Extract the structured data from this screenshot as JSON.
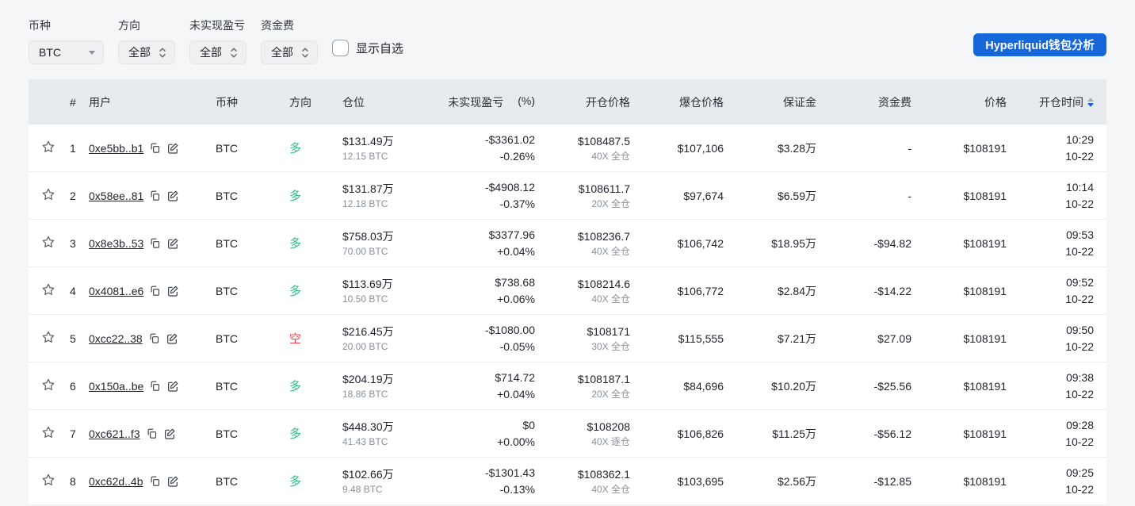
{
  "filters": {
    "coin_label": "币种",
    "coin_value": "BTC",
    "direction_label": "方向",
    "direction_value": "全部",
    "pnl_label": "未实现盈亏",
    "pnl_value": "全部",
    "funding_label": "资金费",
    "funding_value": "全部",
    "show_favorites_label": "显示自选"
  },
  "wallet_button_label": "Hyperliquid钱包分析",
  "colors": {
    "accent": "#1667d9",
    "green": "#2ebd85",
    "red": "#ef454a"
  },
  "table": {
    "headers": {
      "rank": "#",
      "user": "用户",
      "coin": "币种",
      "direction": "方向",
      "position": "仓位",
      "pnl": "未实现盈亏",
      "pnl_pct": "(%)",
      "open_price": "开仓价格",
      "liq_price": "爆仓价格",
      "margin": "保证金",
      "funding": "资金费",
      "price": "价格",
      "open_time": "开仓时间"
    },
    "rows": [
      {
        "rank": "1",
        "user": "0xe5bb..b1",
        "coin": "BTC",
        "direction": "多",
        "direction_type": "long",
        "position_usd": "$131.49万",
        "position_coin": "12.15 BTC",
        "pnl": "-$3361.02",
        "pnl_pct": "-0.26%",
        "pnl_type": "negative",
        "open_price": "$108487.5",
        "leverage": "40X 全仓",
        "liq_price": "$107,106",
        "margin": "$3.28万",
        "funding": "-",
        "funding_type": "neutral",
        "price": "$108191",
        "time": "10:29",
        "date": "10-22"
      },
      {
        "rank": "2",
        "user": "0x58ee..81",
        "coin": "BTC",
        "direction": "多",
        "direction_type": "long",
        "position_usd": "$131.87万",
        "position_coin": "12.18 BTC",
        "pnl": "-$4908.12",
        "pnl_pct": "-0.37%",
        "pnl_type": "negative",
        "open_price": "$108611.7",
        "leverage": "20X 全仓",
        "liq_price": "$97,674",
        "margin": "$6.59万",
        "funding": "-",
        "funding_type": "neutral",
        "price": "$108191",
        "time": "10:14",
        "date": "10-22"
      },
      {
        "rank": "3",
        "user": "0x8e3b..53",
        "coin": "BTC",
        "direction": "多",
        "direction_type": "long",
        "position_usd": "$758.03万",
        "position_coin": "70.00 BTC",
        "pnl": "$3377.96",
        "pnl_pct": "+0.04%",
        "pnl_type": "positive",
        "open_price": "$108236.7",
        "leverage": "40X 全仓",
        "liq_price": "$106,742",
        "margin": "$18.95万",
        "funding": "-$94.82",
        "funding_type": "negative",
        "price": "$108191",
        "time": "09:53",
        "date": "10-22"
      },
      {
        "rank": "4",
        "user": "0x4081..e6",
        "coin": "BTC",
        "direction": "多",
        "direction_type": "long",
        "position_usd": "$113.69万",
        "position_coin": "10.50 BTC",
        "pnl": "$738.68",
        "pnl_pct": "+0.06%",
        "pnl_type": "positive",
        "open_price": "$108214.6",
        "leverage": "40X 全仓",
        "liq_price": "$106,772",
        "margin": "$2.84万",
        "funding": "-$14.22",
        "funding_type": "negative",
        "price": "$108191",
        "time": "09:52",
        "date": "10-22"
      },
      {
        "rank": "5",
        "user": "0xcc22..38",
        "coin": "BTC",
        "direction": "空",
        "direction_type": "short",
        "position_usd": "$216.45万",
        "position_coin": "20.00 BTC",
        "pnl": "-$1080.00",
        "pnl_pct": "-0.05%",
        "pnl_type": "negative",
        "open_price": "$108171",
        "leverage": "30X 全仓",
        "liq_price": "$115,555",
        "margin": "$7.21万",
        "funding": "$27.09",
        "funding_type": "positive",
        "price": "$108191",
        "time": "09:50",
        "date": "10-22"
      },
      {
        "rank": "6",
        "user": "0x150a..be",
        "coin": "BTC",
        "direction": "多",
        "direction_type": "long",
        "position_usd": "$204.19万",
        "position_coin": "18.86 BTC",
        "pnl": "$714.72",
        "pnl_pct": "+0.04%",
        "pnl_type": "positive",
        "open_price": "$108187.1",
        "leverage": "20X 全仓",
        "liq_price": "$84,696",
        "margin": "$10.20万",
        "funding": "-$25.56",
        "funding_type": "negative",
        "price": "$108191",
        "time": "09:38",
        "date": "10-22"
      },
      {
        "rank": "7",
        "user": "0xc621..f3",
        "coin": "BTC",
        "direction": "多",
        "direction_type": "long",
        "position_usd": "$448.30万",
        "position_coin": "41.43 BTC",
        "pnl": "$0",
        "pnl_pct": "+0.00%",
        "pnl_type": "zero",
        "open_price": "$108208",
        "leverage": "40X 逐仓",
        "liq_price": "$106,826",
        "margin": "$11.25万",
        "funding": "-$56.12",
        "funding_type": "negative",
        "price": "$108191",
        "time": "09:28",
        "date": "10-22"
      },
      {
        "rank": "8",
        "user": "0xc62d..4b",
        "coin": "BTC",
        "direction": "多",
        "direction_type": "long",
        "position_usd": "$102.66万",
        "position_coin": "9.48 BTC",
        "pnl": "-$1301.43",
        "pnl_pct": "-0.13%",
        "pnl_type": "negative",
        "open_price": "$108362.1",
        "leverage": "40X 全仓",
        "liq_price": "$103,695",
        "margin": "$2.56万",
        "funding": "-$12.85",
        "funding_type": "negative",
        "price": "$108191",
        "time": "09:25",
        "date": "10-22"
      }
    ]
  }
}
